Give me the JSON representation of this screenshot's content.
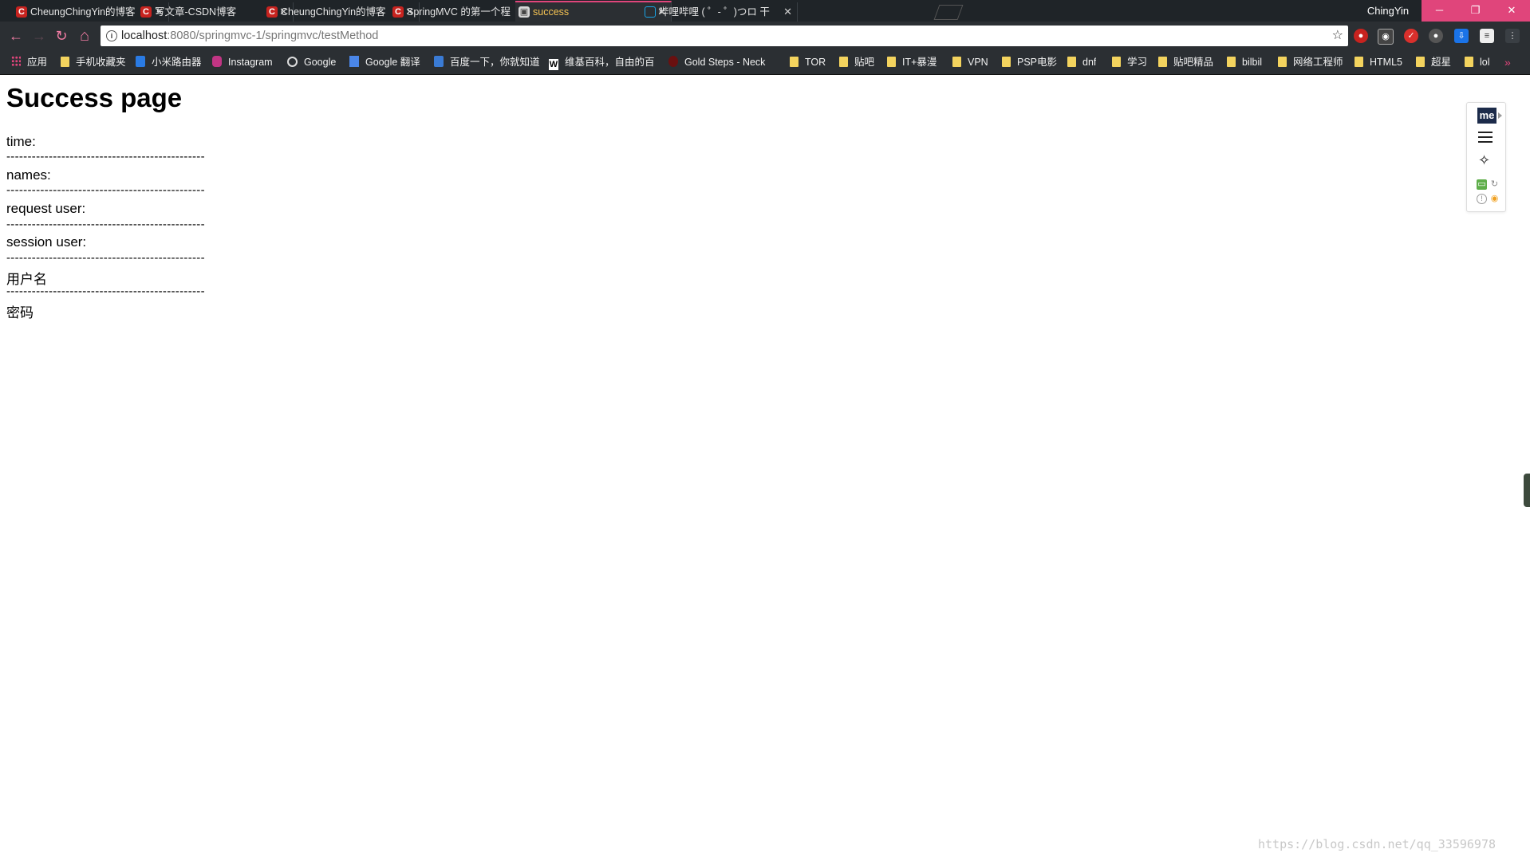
{
  "tabs": [
    {
      "title": "CheungChingYin的博客",
      "icon": "csdn-icon",
      "active": false
    },
    {
      "title": "写文章-CSDN博客",
      "icon": "csdn-icon",
      "active": false
    },
    {
      "title": "CheungChingYin的博客",
      "icon": "csdn-icon",
      "active": false
    },
    {
      "title": "SpringMVC 的第一个程",
      "icon": "csdn-icon",
      "active": false
    },
    {
      "title": "success",
      "icon": "page-icon",
      "active": true
    },
    {
      "title": "哔哩哔哩 ( ゜- ゜)つロ 干",
      "icon": "bilibili-icon",
      "active": false
    }
  ],
  "window": {
    "profile_name": "ChingYin",
    "minimize_glyph": "─",
    "restore_glyph": "❐",
    "close_glyph": "✕"
  },
  "toolbar": {
    "back_glyph": "←",
    "forward_glyph": "→",
    "reload_glyph": "↻",
    "home_glyph": "⌂",
    "url_host": "localhost",
    "url_rest": ":8080/springmvc-1/springmvc/testMethod",
    "star_glyph": "☆"
  },
  "bookmarks": [
    {
      "label": "应用",
      "icon": "apps-icon"
    },
    {
      "label": "手机收藏夹",
      "icon": "folder-icon"
    },
    {
      "label": "小米路由器",
      "icon": "wifi-icon"
    },
    {
      "label": "Instagram",
      "icon": "instagram-icon"
    },
    {
      "label": "Google",
      "icon": "google-icon"
    },
    {
      "label": "Google 翻译",
      "icon": "translate-icon"
    },
    {
      "label": "百度一下，你就知道",
      "icon": "baidu-icon"
    },
    {
      "label": "维基百科，自由的百",
      "icon": "wikipedia-icon"
    },
    {
      "label": "Gold Steps - Neck",
      "icon": "site-icon"
    },
    {
      "label": "TOR",
      "icon": "folder-icon"
    },
    {
      "label": "贴吧",
      "icon": "folder-icon"
    },
    {
      "label": "IT+暴漫",
      "icon": "folder-icon"
    },
    {
      "label": "VPN",
      "icon": "folder-icon"
    },
    {
      "label": "PSP电影",
      "icon": "folder-icon"
    },
    {
      "label": "dnf",
      "icon": "folder-icon"
    },
    {
      "label": "学习",
      "icon": "folder-icon"
    },
    {
      "label": "贴吧精品",
      "icon": "folder-icon"
    },
    {
      "label": "bilbil",
      "icon": "folder-icon"
    },
    {
      "label": "网络工程师",
      "icon": "folder-icon"
    },
    {
      "label": "HTML5",
      "icon": "folder-icon"
    },
    {
      "label": "超星",
      "icon": "folder-icon"
    },
    {
      "label": "lol",
      "icon": "folder-icon"
    }
  ],
  "bookmarks_more_glyph": "»",
  "page": {
    "heading": "Success page",
    "time_label": "time:",
    "names_label": "names:",
    "request_user_label": "request user:",
    "session_user_label": "session user:",
    "username_label": "用户名",
    "password_label": "密码",
    "separator": "-----------------------------------------------"
  },
  "widget": {
    "logo_text": "me"
  },
  "watermark": "https://blog.csdn.net/qq_33596978",
  "colors": {
    "accent": "#e0457b",
    "frame": "#2b2f33",
    "tab_strip": "#1f2428",
    "active_tab_text": "#f6c453"
  }
}
